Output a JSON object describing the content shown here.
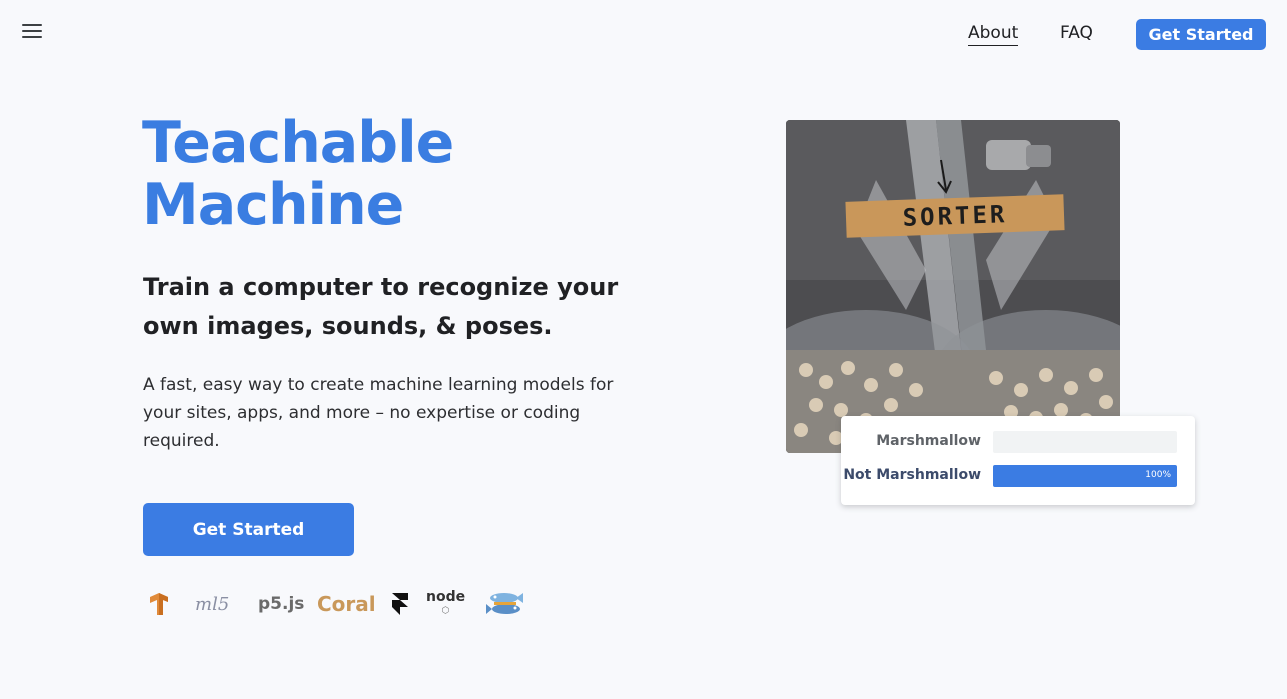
{
  "header": {
    "menu_icon": "hamburger-menu-icon",
    "nav": {
      "about": "About",
      "faq": "FAQ",
      "get_started": "Get Started"
    }
  },
  "hero": {
    "title_line1": "Teachable",
    "title_line2": "Machine",
    "subtitle": "Train a computer to recognize your own images, sounds, & poses.",
    "description": "A fast, easy way to create machine learning models for your sites, apps, and more – no expertise or coding required.",
    "cta": "Get Started"
  },
  "logos": {
    "tensorflow": "tensorflow-icon",
    "ml5": "ml5",
    "p5": "p5.js",
    "coral": "Coral",
    "framer": "framer-icon",
    "node": "node",
    "glitch": "glitch-fish-icon"
  },
  "demo": {
    "image_label": "SORTER",
    "classes": [
      {
        "label": "Marshmallow",
        "confidence": 0,
        "pct_text": ""
      },
      {
        "label": "Not Marshmallow",
        "confidence": 1.0,
        "pct_text": "100%"
      }
    ]
  },
  "colors": {
    "accent": "#3b7ce3",
    "background": "#f8f9fc",
    "title_blue": "#3a7de1"
  }
}
